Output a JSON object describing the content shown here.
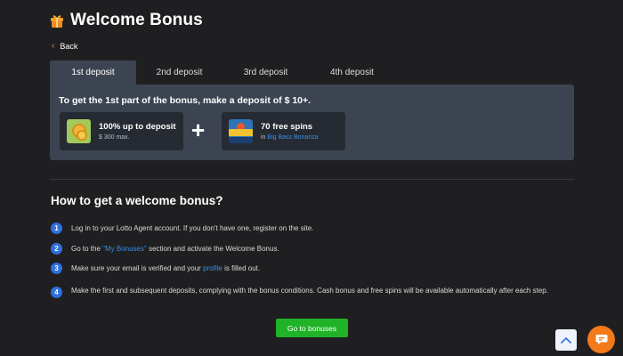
{
  "page": {
    "title": "Welcome Bonus",
    "title_icon": "gift-icon",
    "back_label": "Back"
  },
  "tabs": [
    {
      "label": "1st deposit",
      "active": true
    },
    {
      "label": "2nd deposit",
      "active": false
    },
    {
      "label": "3rd deposit",
      "active": false
    },
    {
      "label": "4th deposit",
      "active": false
    }
  ],
  "deposit_panel": {
    "headline": "To get the 1st part of the bonus, make a deposit of $ 10+.",
    "cash_bonus": {
      "main": "100% up to deposit",
      "sub": "$ 300 max.",
      "icon": "coins-icon"
    },
    "plus": "+",
    "free_spins": {
      "main": "70 free spins",
      "sub_prefix": "in ",
      "game": "Big Bass Bonanza",
      "icon": "slot-game-icon"
    }
  },
  "how_to": {
    "title": "How to get a welcome bonus?",
    "steps": [
      {
        "num": "1",
        "text": "Log in to your Lotto Agent account. If you don't have one, register on the site."
      },
      {
        "num": "2",
        "text_before": "Go to the ",
        "link": "\"My Bonuses\"",
        "text_after": " section and activate the Welcome Bonus."
      },
      {
        "num": "3",
        "text_before": "Make sure your email is verified and your ",
        "link": "profile",
        "text_after": " is filled out."
      },
      {
        "num": "4",
        "text": "Make the first and subsequent deposits, complying with the bonus conditions. Cash bonus and free spins will be available automatically after each step."
      }
    ]
  },
  "go_button_label": "Go to bonuses",
  "colors": {
    "background": "#1f1f21",
    "panel": "#3d4451",
    "accent_green": "#20b327",
    "accent_blue": "#2f6fde",
    "accent_orange": "#f27a1a"
  }
}
